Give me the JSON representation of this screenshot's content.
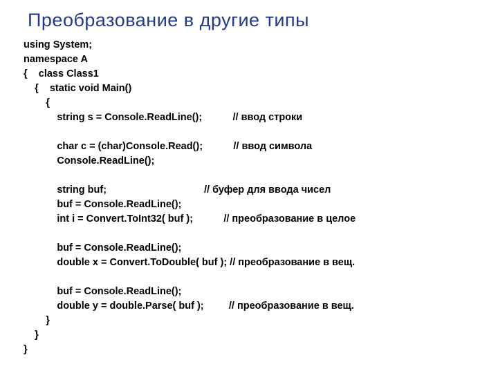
{
  "title": "Преобразование в другие типы",
  "code": "using System;\nnamespace A\n{    class Class1\n    {    static void Main()\n        {\n            string s = Console.ReadLine();           // ввод строки\n\n            char c = (char)Console.Read();           // ввод символа\n            Console.ReadLine();\n\n            string buf;                                   // буфер для ввода чисел\n            buf = Console.ReadLine();\n            int i = Convert.ToInt32( buf );           // преобразование в целое\n\n            buf = Console.ReadLine();\n            double x = Convert.ToDouble( buf ); // преобразование в вещ.\n\n            buf = Console.ReadLine();\n            double y = double.Parse( buf );         // преобразование в вещ.\n        }\n    }\n}"
}
